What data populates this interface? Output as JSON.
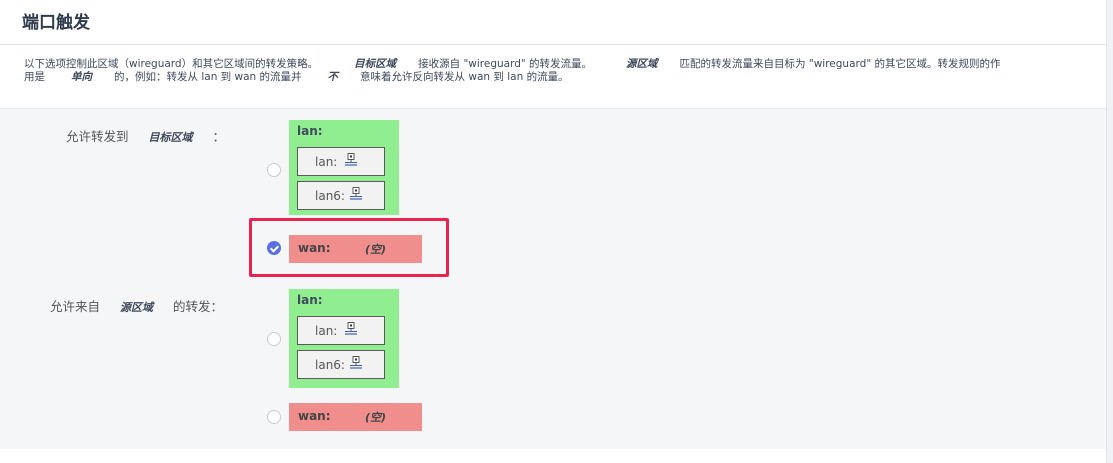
{
  "header": {
    "title": "端口触发"
  },
  "description": {
    "part1": "以下选项控制此区域（wireguard）和其它区域间的转发策略。",
    "em1": "目标区域",
    "part2": "接收源自 \"wireguard\" 的转发流量。",
    "em2": "源区域",
    "part3": "匹配的转发流量来自目标为 \"wireguard\" 的其它区域。转发规则的作",
    "part4": "用是",
    "em3": "单向",
    "part5": "的，例如：转发从 lan 到 wan 的流量并",
    "em4": "不",
    "part6": "意味着允许反向转发从 wan 到 lan 的流量。"
  },
  "forward_to": {
    "label_prefix": "允许转发到",
    "label_em": "目标区域",
    "label_suffix": "：",
    "lan_group": {
      "zone": "lan:",
      "networks": [
        {
          "name": "lan:"
        },
        {
          "name": "lan6:"
        }
      ],
      "checked": false
    },
    "wan_group": {
      "zone": "wan:",
      "empty": "(空)",
      "checked": true
    }
  },
  "forward_from": {
    "label_prefix": "允许来自",
    "label_em": "源区域",
    "label_suffix": "的转发：",
    "lan_group": {
      "zone": "lan:",
      "networks": [
        {
          "name": "lan:"
        },
        {
          "name": "lan6:"
        }
      ],
      "checked": false
    },
    "wan_group": {
      "zone": "wan:",
      "empty": "(空)",
      "checked": false
    }
  },
  "colors": {
    "lan_zone": "#90ee90",
    "wan_zone": "#f08e8e",
    "radio_checked": "#5b6fe0",
    "highlight": "#e8234f"
  },
  "icons": {
    "network": "network-interface-icon"
  }
}
